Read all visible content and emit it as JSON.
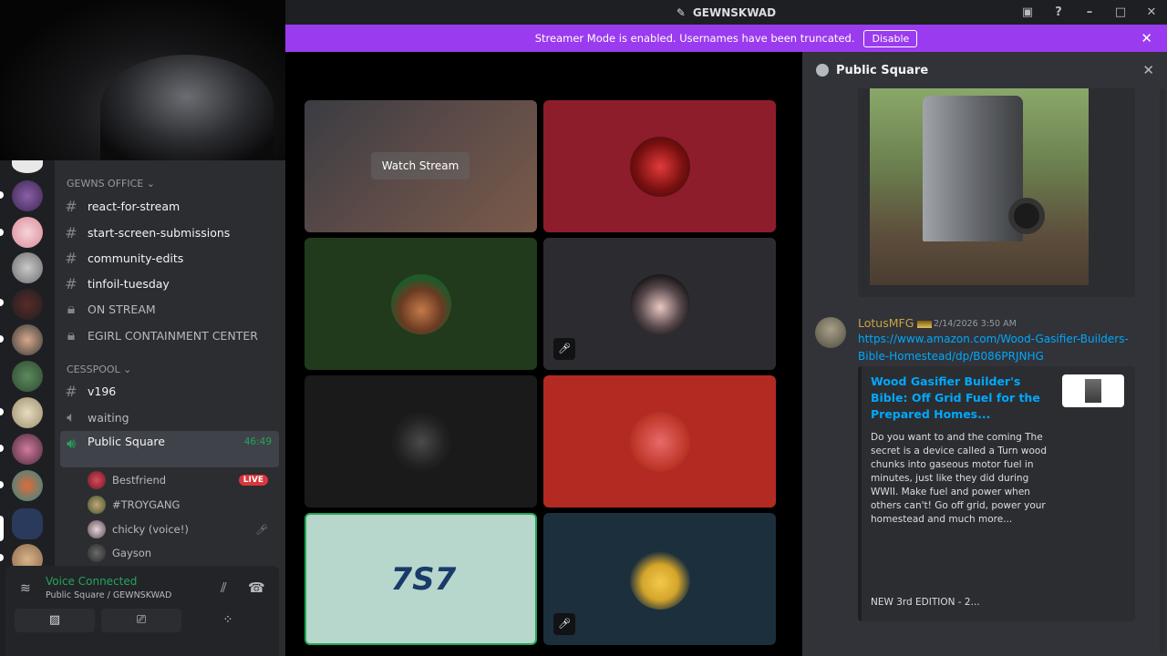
{
  "app": {
    "title": "GEWNSKWAD"
  },
  "banner": {
    "text": "Streamer Mode is enabled. Usernames have been truncated.",
    "button": "Disable"
  },
  "channels": {
    "category_office": "GEWNS OFFICE",
    "office": [
      {
        "name": "react-for-stream",
        "type": "text"
      },
      {
        "name": "start-screen-submissions",
        "type": "text"
      },
      {
        "name": "community-edits",
        "type": "text"
      },
      {
        "name": "tinfoil-tuesday",
        "type": "text"
      },
      {
        "name": "ON STREAM",
        "type": "locked"
      },
      {
        "name": "EGIRL CONTAINMENT CENTER",
        "type": "locked"
      }
    ],
    "category_cesspool": "CESSPOOL",
    "cesspool": [
      {
        "name": "v196",
        "type": "text"
      },
      {
        "name": "waiting",
        "type": "voice"
      }
    ],
    "active_channel": {
      "name": "Public Square",
      "timer": "46:49"
    },
    "voice_users": [
      {
        "name": "Bestfriend",
        "badge": "LIVE"
      },
      {
        "name": "#TROYGANG"
      },
      {
        "name": "chicky (voice!)"
      },
      {
        "name": "Gayson"
      }
    ]
  },
  "voice_panel": {
    "status": "Voice Connected",
    "location": "Public Square / GEWNSKWAD"
  },
  "stage": {
    "watch_label": "Watch Stream"
  },
  "chat": {
    "header": "Public Square",
    "message": {
      "author": "LotusMFG",
      "timestamp": "2/14/2026 3:50 AM",
      "link": "https://www.amazon.com/Wood-Gasifier-Builders-Bible-Homestead/dp/B086PRJNHG",
      "embed": {
        "title": "Wood Gasifier Builder's Bible: Off Grid Fuel for the Prepared Homes...",
        "description": "Do you want to and the coming The secret is a device called a Turn wood chunks into gaseous motor fuel in minutes, just like they did during WWII. Make fuel and power when others can't! Go off grid, power your homestead and much more...",
        "extra": "NEW 3rd EDITION - 2..."
      }
    }
  },
  "colors": {
    "accent": "#9b3bf0",
    "online": "#23a55a",
    "link": "#00a8fc",
    "live": "#da373c"
  },
  "icons": [
    "hashtag-icon",
    "lock-icon",
    "speaker-icon",
    "close-icon",
    "help-icon",
    "mic-muted-icon"
  ]
}
